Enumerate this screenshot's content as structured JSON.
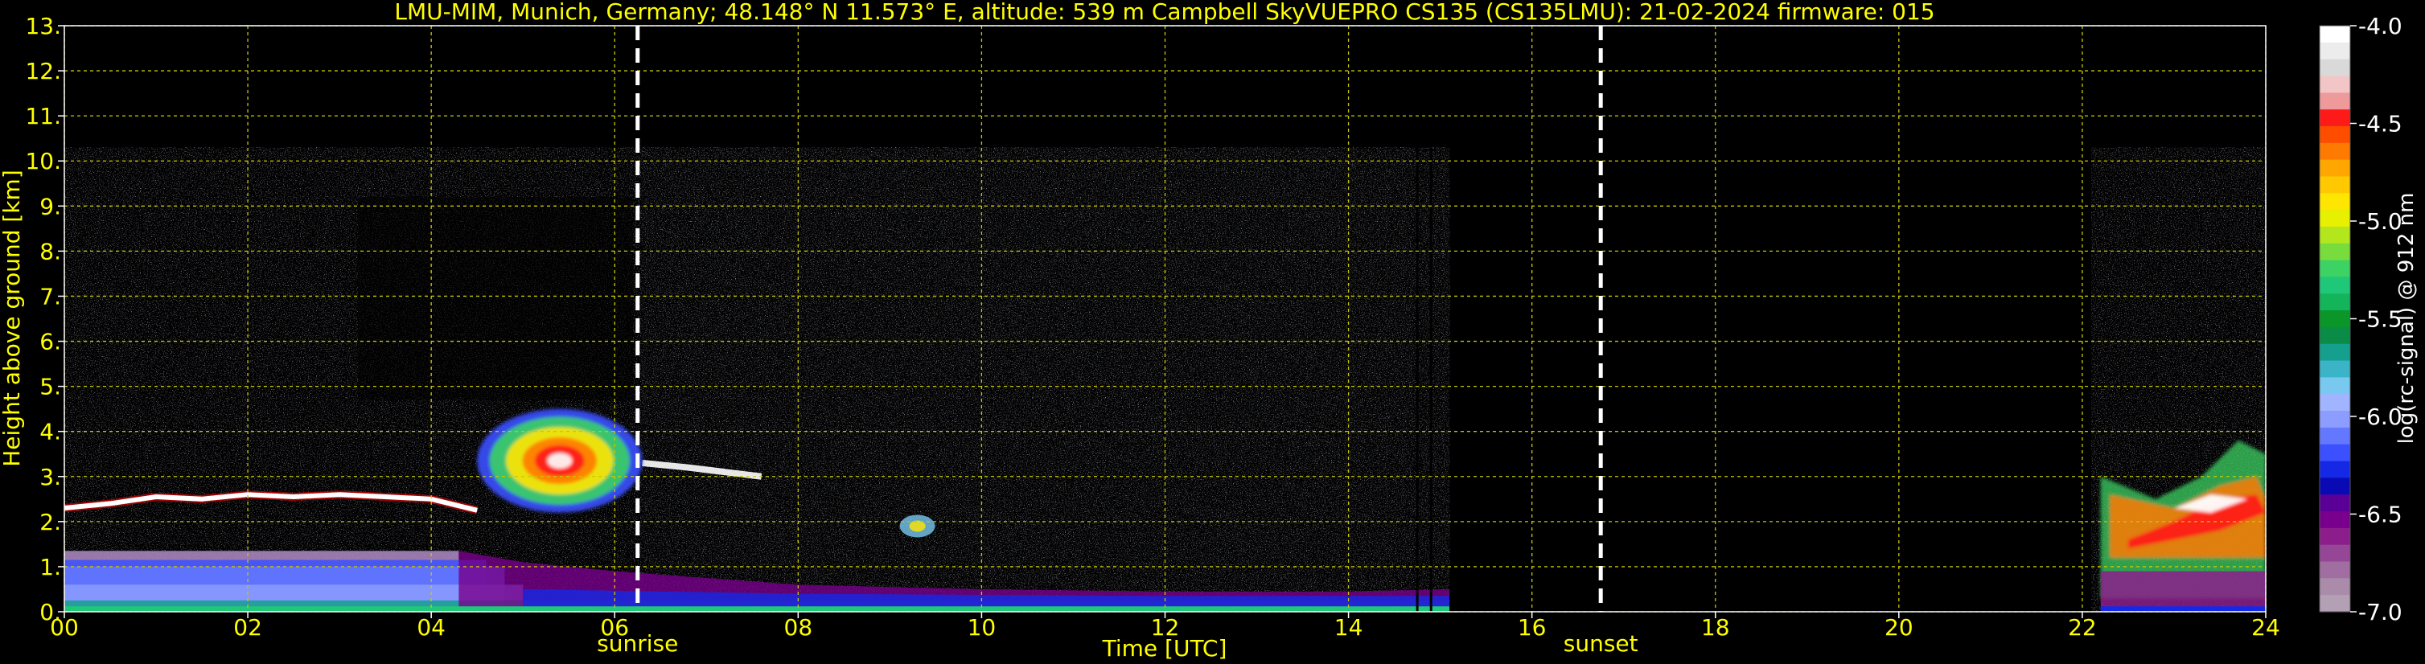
{
  "chart_data": {
    "type": "heatmap",
    "title": "LMU-MIM, Munich, Germany; 48.148° N 11.573° E, altitude: 539 m    Campbell SkyVUEPRO CS135 (CS135LMU): 21-02-2024    firmware: 015",
    "xlabel": "Time [UTC]",
    "ylabel": "Height above ground [km]",
    "xlim": [
      0,
      24
    ],
    "ylim": [
      0,
      13
    ],
    "x_ticks": [
      "00",
      "02",
      "04",
      "06",
      "08",
      "10",
      "12",
      "14",
      "16",
      "18",
      "20",
      "22",
      "24"
    ],
    "y_ticks": [
      "0.",
      "1.",
      "2.",
      "3.",
      "4.",
      "5.",
      "6.",
      "7.",
      "8.",
      "9.",
      "10.",
      "11.",
      "12.",
      "13."
    ],
    "grid": true,
    "colorbar": {
      "label": "log(rc-signal) @ 912 nm",
      "range": [
        -7.0,
        -4.0
      ],
      "ticks": [
        "-4.0",
        "-4.5",
        "-5.0",
        "-5.5",
        "-6.0",
        "-6.5",
        "-7.0"
      ],
      "colors": [
        "#ffffff",
        "#ececec",
        "#d9d9d9",
        "#f2c6c6",
        "#ee9a9a",
        "#ff1a1a",
        "#ff4d00",
        "#ff7a00",
        "#ffa600",
        "#ffc800",
        "#ffe600",
        "#e6f000",
        "#b4e61e",
        "#78dc3c",
        "#3cd264",
        "#1ec878",
        "#14b45a",
        "#0a9628",
        "#0a8c46",
        "#14a08c",
        "#3cb4c8",
        "#78c8f0",
        "#a0b4ff",
        "#8c9cff",
        "#6478ff",
        "#3c50ff",
        "#1428e6",
        "#0a0ab4",
        "#5a0096",
        "#78008c",
        "#8c1e8c",
        "#964696",
        "#a06ea0",
        "#aa8caa",
        "#b4a0b4"
      ]
    },
    "annotations": [
      {
        "label": "sunrise",
        "x": 6.25
      },
      {
        "label": "sunset",
        "x": 16.75
      }
    ],
    "data_gaps": [
      [
        15.1,
        22.1
      ]
    ],
    "features": [
      {
        "kind": "boundary layer top",
        "x": [
          0,
          0.5,
          1,
          1.5,
          2,
          2.5,
          3,
          3.5,
          4,
          4.5
        ],
        "y": [
          2.3,
          2.4,
          2.55,
          2.5,
          2.6,
          2.55,
          2.6,
          2.55,
          2.5,
          2.25
        ]
      },
      {
        "kind": "cloud",
        "x": [
          4.5,
          6.3
        ],
        "y": [
          2.2,
          4.5
        ]
      },
      {
        "kind": "cloud",
        "x": [
          22.2,
          24
        ],
        "y": [
          0.3,
          3.9
        ]
      }
    ]
  }
}
